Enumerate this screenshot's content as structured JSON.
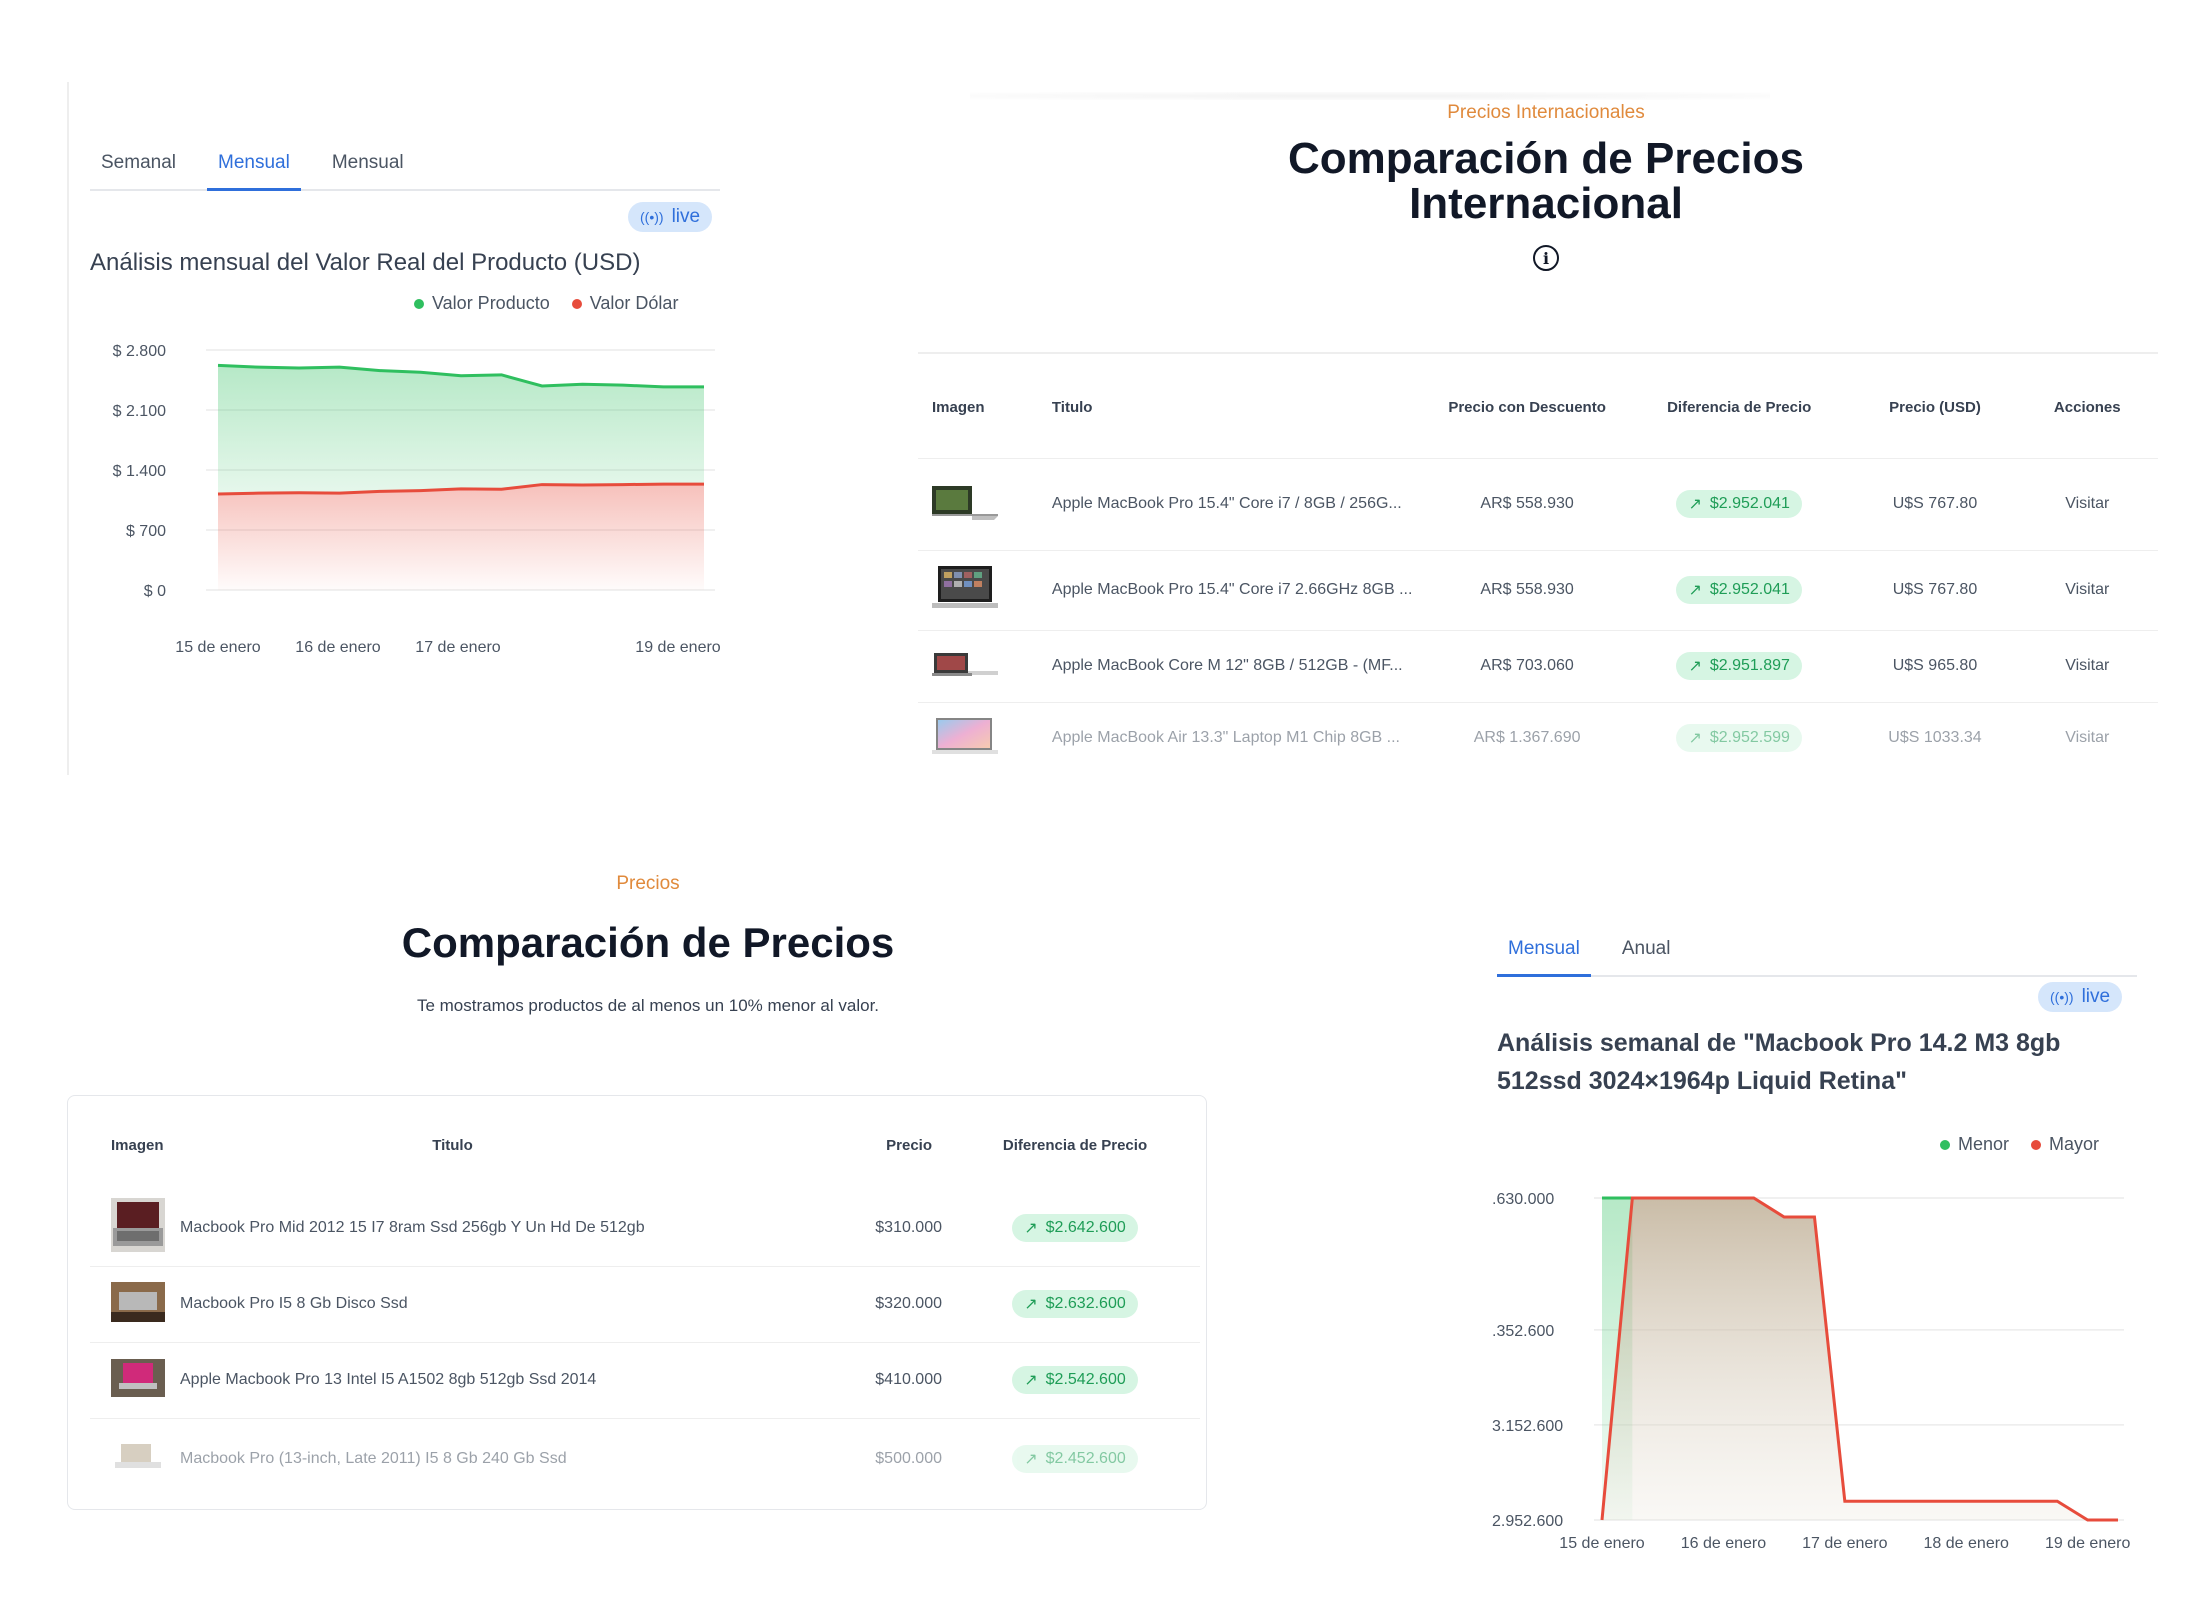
{
  "panel1": {
    "tabs": [
      {
        "label": "Semanal",
        "active": false
      },
      {
        "label": "Mensual",
        "active": true
      },
      {
        "label": "Mensual",
        "active": false
      }
    ],
    "live_label": "live",
    "title": "Análisis mensual del Valor Real del Producto (USD)",
    "legend": [
      {
        "label": "Valor Producto",
        "color": "#2fbf5f"
      },
      {
        "label": "Valor Dólar",
        "color": "#e74c3c"
      }
    ],
    "chart_data": {
      "type": "area",
      "title": "Análisis mensual del Valor Real del Producto (USD)",
      "x_tick_labels": [
        "15 de enero",
        "16 de enero",
        "17 de enero",
        "19 de enero"
      ],
      "y_tick_labels": [
        "$ 2.800",
        "$ 2.100",
        "$ 1.400",
        "$ 700",
        "$ 0"
      ],
      "ylim": [
        0,
        2800
      ],
      "grid": true,
      "legend_position": "top-right",
      "series": [
        {
          "name": "Valor Producto",
          "color": "#2fbf5f",
          "values": [
            2620,
            2600,
            2590,
            2600,
            2560,
            2540,
            2500,
            2510,
            2380,
            2400,
            2390,
            2370,
            2370
          ]
        },
        {
          "name": "Valor Dólar",
          "color": "#e74c3c",
          "values": [
            1120,
            1130,
            1135,
            1130,
            1150,
            1160,
            1180,
            1175,
            1230,
            1225,
            1230,
            1235,
            1235
          ]
        }
      ]
    }
  },
  "panel2": {
    "eyebrow": "Precios Internacionales",
    "title_line1": "Comparación de Precios",
    "title_line2": "Internacional",
    "info_glyph": "i",
    "headers": [
      "Imagen",
      "Titulo",
      "Precio con Descuento",
      "Diferencia de Precio",
      "Precio (USD)",
      "Acciones"
    ],
    "rows": [
      {
        "thumb": "laptop-green",
        "title": "Apple MacBook Pro 15.4\" Core i7 / 8GB / 256G...",
        "discount_price": "AR$ 558.930",
        "diff": "$2.952.041",
        "usd": "U$S 767.80",
        "action": "Visitar"
      },
      {
        "thumb": "laptop-dark",
        "title": "Apple MacBook Pro 15.4\" Core i7 2.66GHz 8GB ...",
        "discount_price": "AR$ 558.930",
        "diff": "$2.952.041",
        "usd": "U$S 767.80",
        "action": "Visitar"
      },
      {
        "thumb": "laptop-red",
        "title": "Apple MacBook Core M 12\" 8GB / 512GB - (MF...",
        "discount_price": "AR$ 703.060",
        "diff": "$2.951.897",
        "usd": "U$S 965.80",
        "action": "Visitar"
      },
      {
        "thumb": "laptop-pink",
        "title": "Apple MacBook Air 13.3\" Laptop M1 Chip 8GB ...",
        "discount_price": "AR$ 1.367.690",
        "diff": "$2.952.599",
        "usd": "U$S 1033.34",
        "action": "Visitar"
      }
    ],
    "diff_arrow": "↗"
  },
  "panel3": {
    "eyebrow": "Precios",
    "title": "Comparación de Precios",
    "description": "Te mostramos productos de al menos un 10% menor al valor.",
    "headers": [
      "Imagen",
      "Titulo",
      "Precio",
      "Diferencia de Precio"
    ],
    "rows": [
      {
        "thumb": "laptop-photo-1",
        "title": "Macbook Pro Mid 2012 15 I7 8ram Ssd 256gb Y Un Hd De 512gb",
        "price": "$310.000",
        "diff": "$2.642.600"
      },
      {
        "thumb": "laptop-photo-2",
        "title": "Macbook Pro I5 8 Gb Disco Ssd",
        "price": "$320.000",
        "diff": "$2.632.600"
      },
      {
        "thumb": "laptop-photo-3",
        "title": "Apple Macbook Pro 13 Intel I5 A1502 8gb 512gb Ssd 2014",
        "price": "$410.000",
        "diff": "$2.542.600"
      },
      {
        "thumb": "laptop-photo-4",
        "title": "Macbook Pro (13-inch, Late 2011) I5 8 Gb 240 Gb Ssd",
        "price": "$500.000",
        "diff": "$2.452.600"
      }
    ],
    "diff_arrow": "↗"
  },
  "panel4": {
    "tabs": [
      {
        "label": "Mensual",
        "active": true
      },
      {
        "label": "Anual",
        "active": false
      }
    ],
    "live_label": "live",
    "title_line1": "Análisis semanal de \"Macbook Pro 14.2 M3 8gb",
    "title_line2": "512ssd 3024×1964p Liquid Retina\"",
    "legend": [
      {
        "label": "Menor",
        "color": "#2fbf5f"
      },
      {
        "label": "Mayor",
        "color": "#e74c3c"
      }
    ],
    "chart_data": {
      "type": "area",
      "title": "Análisis semanal de \"Macbook Pro 14.2 M3 8gb 512ssd 3024×1964p Liquid Retina\"",
      "x_tick_labels": [
        "15 de enero",
        "16 de enero",
        "17 de enero",
        "18 de enero",
        "19 de enero"
      ],
      "y_tick_labels": [
        ".630.000",
        ".352.600",
        "3.152.600",
        "2.952.600"
      ],
      "y_tick_values": [
        3630000,
        3352600,
        3152600,
        2952600
      ],
      "ylim": [
        2952600,
        3630000
      ],
      "grid": true,
      "legend_position": "top-right",
      "series": [
        {
          "name": "Menor",
          "color": "#2fbf5f",
          "x": [
            0,
            0.25,
            1.25,
            1.5,
            2.0,
            4.0
          ],
          "values": [
            3630000,
            3630000,
            3630000,
            3630000,
            3630000,
            3630000
          ]
        },
        {
          "name": "Mayor",
          "color": "#e74c3c",
          "x": [
            0,
            0.25,
            1.25,
            1.5,
            1.75,
            2.0,
            3.75,
            4.0,
            4.25
          ],
          "values": [
            2952600,
            3630000,
            3630000,
            3590000,
            3590000,
            2992000,
            2992000,
            2952600,
            2952600
          ]
        }
      ]
    }
  }
}
